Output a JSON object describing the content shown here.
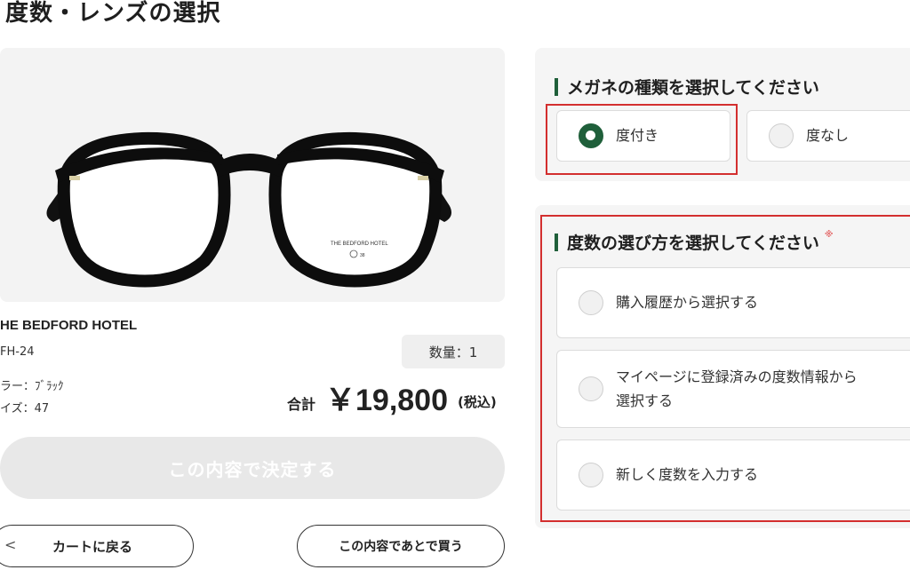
{
  "page": {
    "title": "度数・レンズの選択"
  },
  "product": {
    "brand": "HE BEDFORD HOTEL",
    "model": "FH-24",
    "color": "ラー：ﾌﾞﾗｯｸ",
    "size": "イズ：47",
    "quantity": "数量：1",
    "frame_engraving": "THE BEDFORD HOTEL",
    "frame_engraving_2": "38"
  },
  "total": {
    "label": "合計",
    "price": "￥19,800",
    "tax": "(税込)"
  },
  "actions": {
    "confirm": "この内容で決定する",
    "back_to_cart": "カートに戻る",
    "buy_later": "この内容であとで買う",
    "back_chevron": "<"
  },
  "lens_type": {
    "heading": "メガネの種類を選択してください",
    "options": [
      {
        "label": "度付き",
        "selected": true
      },
      {
        "label": "度なし",
        "selected": false
      }
    ]
  },
  "prescription_method": {
    "heading": "度数の選び方を選択してください",
    "required_mark": "※",
    "options": [
      {
        "label": "購入履歴から選択する",
        "selected": false
      },
      {
        "label_line1": "マイページに登録済みの度数情報から",
        "label_line2": "選択する",
        "selected": false
      },
      {
        "label": "新しく度数を入力する",
        "selected": false
      }
    ]
  },
  "colors": {
    "accent": "#1f5f3a",
    "highlight": "#d32f2f",
    "disabled": "#e8e8e8"
  }
}
